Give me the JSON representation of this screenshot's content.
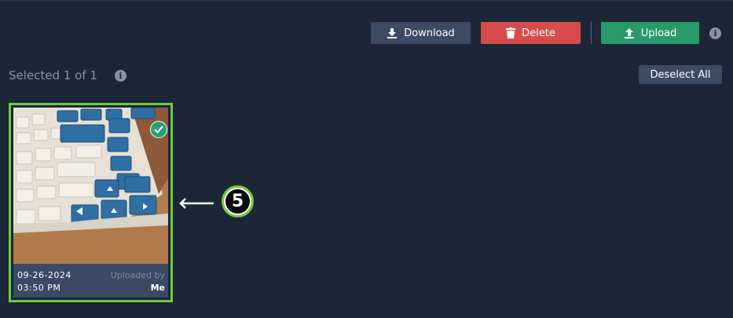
{
  "toolbar": {
    "download_label": "Download",
    "delete_label": "Delete",
    "upload_label": "Upload",
    "info_icon": "i"
  },
  "selection": {
    "status": "Selected 1 of 1",
    "info_icon": "i",
    "deselect_label": "Deselect All"
  },
  "photo": {
    "date": "09-26-2024",
    "time": "03:50 PM",
    "uploaded_by_label": "Uploaded by",
    "uploader": "Me",
    "selected": true,
    "image_description": "keyboard-photo"
  },
  "annotation": {
    "step_number": "5"
  },
  "colors": {
    "background": "#1d2636",
    "download": "#3b4b62",
    "delete": "#d64c4c",
    "upload": "#2b9a6b",
    "selection_border": "#6ecb3f",
    "check": "#2f9e72"
  }
}
